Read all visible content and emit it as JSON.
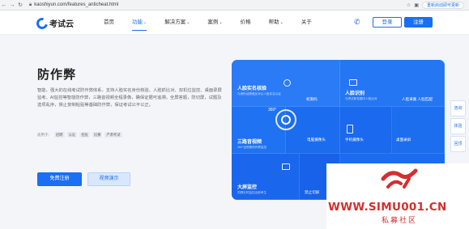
{
  "browser": {
    "url": "kaoshiyun.com/features_anticheat.html",
    "profile_label": "重新启动即可更新"
  },
  "header": {
    "logo_text": "考试云",
    "nav": [
      {
        "label": "首页"
      },
      {
        "label": "功能"
      },
      {
        "label": "解决方案"
      },
      {
        "label": "案例"
      },
      {
        "label": "价格"
      },
      {
        "label": "帮助"
      },
      {
        "label": "关于"
      }
    ],
    "login_label": "登录",
    "register_label": "注册"
  },
  "hero": {
    "title": "防作弊",
    "description": "智能、强大的在线考试防作弊体系，支持人脸实名身份核验、人脸抓比对、双机位监控、桌面录屏监考、AI监控等智能防作弊，三路音视频全程录像，确保证据可追溯。全屏答题，防切屏，试题及选项乱序，禁止复制粘贴等基础防作弊，保证考试公平公正。",
    "scene_label": "适用于：",
    "tags": [
      "招聘",
      "认证",
      "招投",
      "比赛",
      "严肃考试"
    ],
    "trial_label": "免费注册",
    "video_label": "视频演示"
  },
  "panel": {
    "face_verify_title": "人脸实名核验",
    "face_verify_sub": "与身份证照做比对以人脸实名认证",
    "face_detect_title": "人脸识别",
    "face_detect_sub": "与考试和答题中人脸比对",
    "av_title": "三路音视频",
    "av_sub": "360°全视角防作弊监控",
    "screen_title": "大屏监控",
    "screen_sub": "同屏实时监控全部考生",
    "permission_label": "权限码",
    "face_capture_label": "人脸采集 人脸匹配",
    "pc_camera_label": "电脑摄像头",
    "phone_camera_label": "手机摄像头",
    "desktop_record_label": "桌面录屏",
    "tab_switch_label": "禁止切屏",
    "degree_label": "360°"
  },
  "side_tabs": [
    "咨询",
    "体验",
    "回顶"
  ],
  "watermark": {
    "url_text": "WWW.SIMU001.CN",
    "cn_text": "私募社区"
  },
  "colors": {
    "brand": "#1a6ff2",
    "watermark": "#d32f2f"
  }
}
